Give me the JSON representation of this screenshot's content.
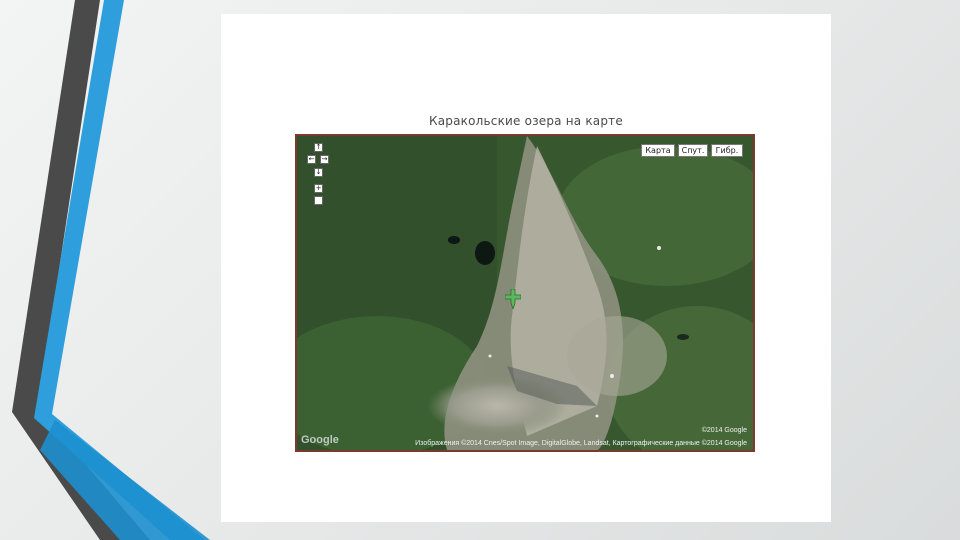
{
  "slide": {
    "title": "Каракольские озера на карте"
  },
  "map": {
    "view_type": "satellite",
    "controls": {
      "pan_up": "↑",
      "pan_left": "←",
      "pan_right": "→",
      "pan_down": "↓",
      "zoom_in": "+",
      "zoom_out": ""
    },
    "map_types": [
      "Карта",
      "Спут.",
      "Гибр."
    ],
    "logo": "Google",
    "copyright_top": "©2014 Google",
    "attribution": "Изображения ©2014 Cnes/Spot Image, DigitalGlobe, Landsat, Картографические данные ©2014 Google"
  },
  "colors": {
    "frame_border": "#7a3a2e",
    "decor_blue": "#2e9fdc",
    "decor_gray": "#4a4a4a",
    "marker_green": "#5cb85c"
  }
}
